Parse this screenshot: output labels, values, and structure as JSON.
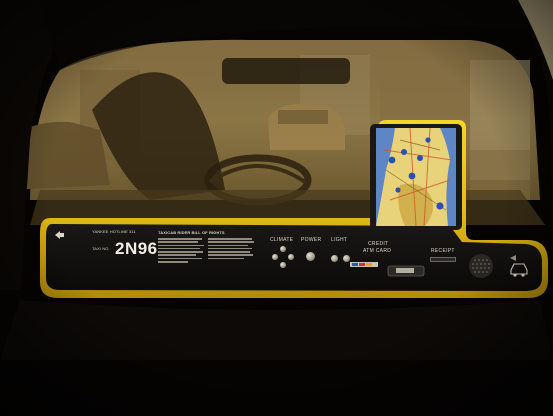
{
  "panel": {
    "header_text": "YANKEE HOTLINE 311",
    "taxi_no_label": "TAXI NO.",
    "taxi_number": "2N96",
    "rights_title": "TAXICAB RIDER BILL OF RIGHTS",
    "climate_label": "CLIMATE",
    "power_label": "POWER",
    "light_label": "LIGHT",
    "credit_label": "CREDIT",
    "atm_card_label": "ATM CARD",
    "receipt_label": "RECEIPT"
  },
  "colors": {
    "panel_yellow": "#e6c21a",
    "panel_black": "#111010",
    "screen_bezel": "#e7c31b",
    "map_land": "#e8d37a",
    "map_water": "#5f86c4",
    "marker": "#2a4fb5"
  },
  "icons": {
    "left_arrow": "arrow-left-icon",
    "car": "car-icon",
    "speaker": "speaker-grille-icon"
  }
}
